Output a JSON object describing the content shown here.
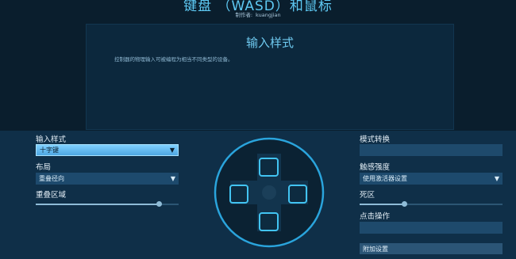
{
  "header": {
    "title": "键盘 （WASD）和鼠标",
    "author_label": "制作者:",
    "author_name": "kuangjian"
  },
  "description": {
    "title": "输入样式",
    "text": "控制器的物理输入可被编程为相当不同类型的设备。"
  },
  "left_panel": {
    "input_style": {
      "label": "输入样式",
      "value": "十字键"
    },
    "layout": {
      "label": "布局",
      "value": "重叠径向"
    },
    "overlap_area": {
      "label": "重叠区域",
      "level_percent": 86
    }
  },
  "right_panel": {
    "mode_switch": {
      "label": "模式转换",
      "value": ""
    },
    "sensitivity": {
      "label": "触感强度",
      "value": "使用激活器设置"
    },
    "deadzone": {
      "label": "死区",
      "level_percent": 31
    },
    "click_action": {
      "label": "点击操作",
      "value": ""
    },
    "extra_settings": {
      "label": "附加设置"
    }
  },
  "icons": {
    "chevron": "chevron-down-icon",
    "dpad": "dpad-icon"
  },
  "colors": {
    "accent": "#5ec9f3",
    "selected_dropdown": "#6cc6f7",
    "panel_bg": "#0f2f48"
  }
}
